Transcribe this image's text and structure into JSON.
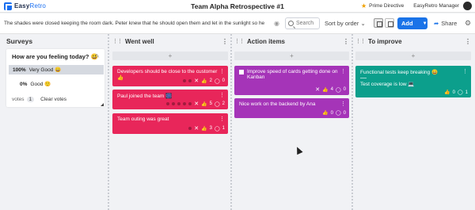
{
  "header": {
    "logo_word1": "Easy",
    "logo_word2": "Retro",
    "title": "Team Alpha Retrospective #1",
    "prime_label": "Prime Directive",
    "user_name": "EasyRetro Manager"
  },
  "toolbar": {
    "description": "The shades were closed keeping the room dark. Peter knew that he should open them and let in the sunlight so he cou",
    "search_placeholder": "Search",
    "sort_label": "Sort by order",
    "add_label": "Add",
    "share_label": "Share"
  },
  "columns": [
    {
      "title": "Surveys"
    },
    {
      "title": "Went well",
      "add_label": "+"
    },
    {
      "title": "Action items",
      "add_label": "+"
    },
    {
      "title": "To improve",
      "add_label": "+"
    }
  ],
  "survey": {
    "question": "How are you feeling today? 😃",
    "options": [
      {
        "percent": "100%",
        "label": "Very Good 😄"
      },
      {
        "percent": "0%",
        "label": "Good 🙂"
      }
    ],
    "votes_label": "votes",
    "votes_count": "1",
    "clear_label": "Clear votes"
  },
  "cards": {
    "went_well": [
      {
        "text": "Developers should be close to the customer 👍",
        "likes": "2",
        "comments": "0"
      },
      {
        "text": "Paul joined the team 🎆",
        "likes": "5",
        "comments": "2"
      },
      {
        "text": "Team outing was great",
        "likes": "3",
        "comments": "1"
      }
    ],
    "action_items": [
      {
        "text": "Improve speed of cards getting done on Kanban",
        "likes": "4",
        "comments": "0"
      },
      {
        "text": "Nice work on the backend by Ana",
        "likes": "0",
        "comments": "0"
      }
    ],
    "to_improve": [
      {
        "text": "Functional tests keep breaking 😀",
        "text2": "Test coverage is low 💻",
        "likes": "0",
        "comments": "1"
      }
    ]
  },
  "colors": {
    "went_well": "#e8265a",
    "action_items": "#a534b8",
    "to_improve": "#0c9f8c",
    "accent": "#1a73e8"
  }
}
